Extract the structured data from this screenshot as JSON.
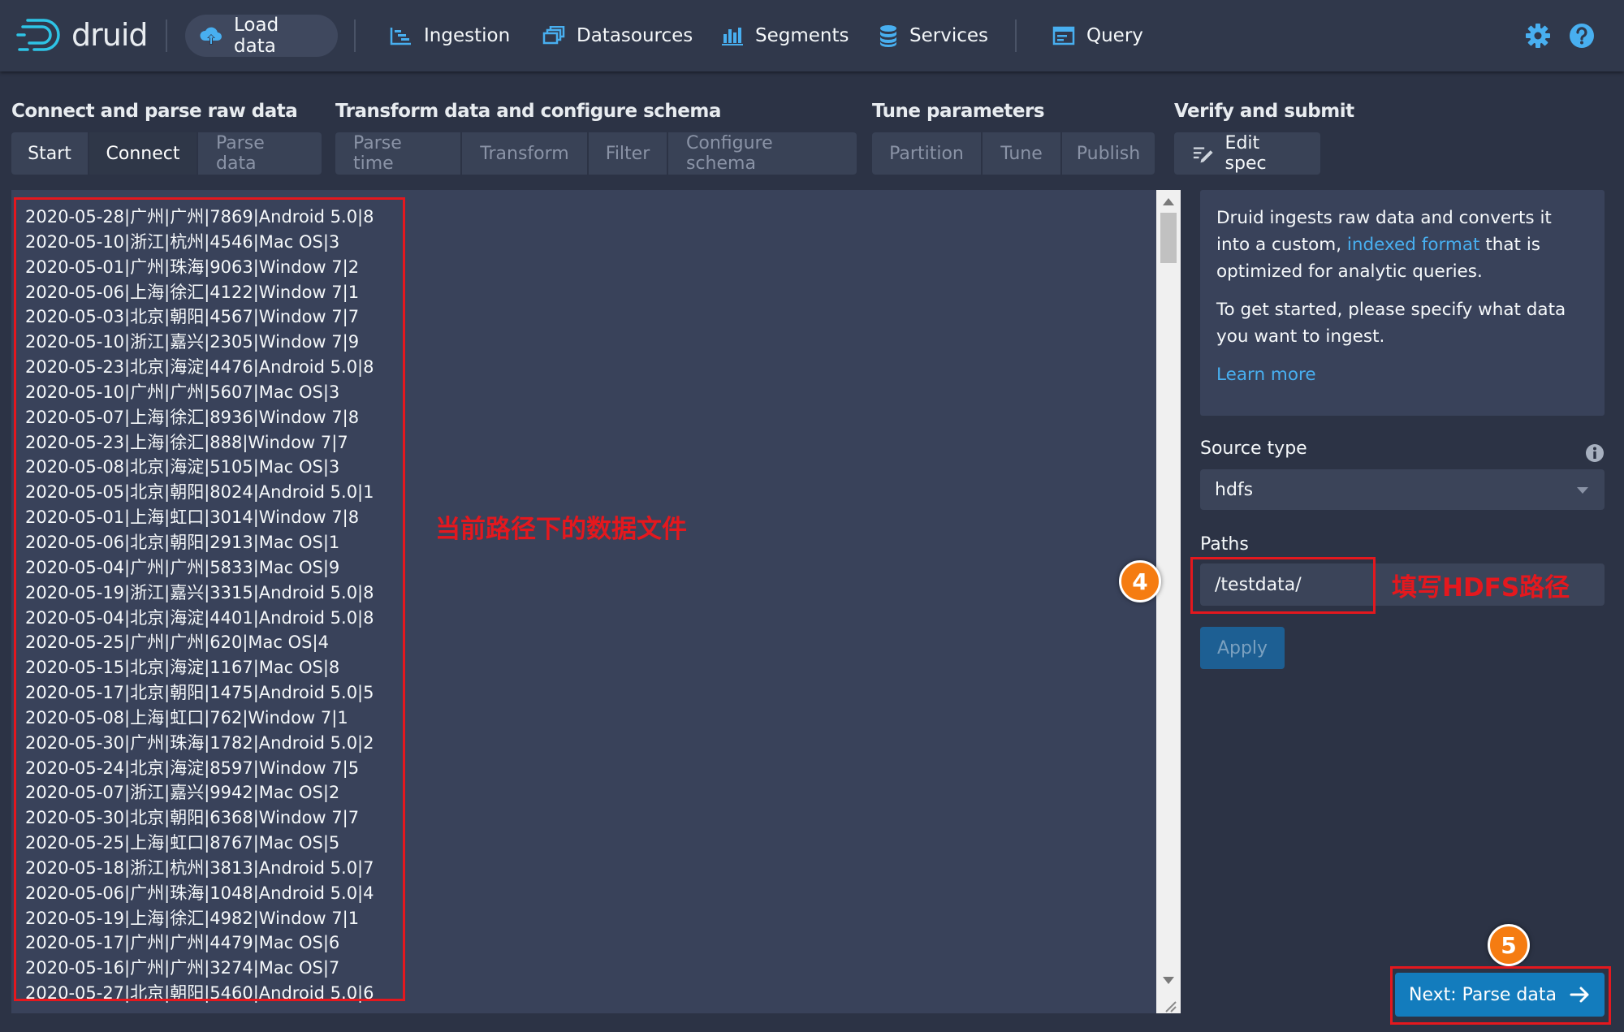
{
  "header": {
    "logo_text": "druid",
    "nav": {
      "load_data": "Load data",
      "ingestion": "Ingestion",
      "datasources": "Datasources",
      "segments": "Segments",
      "services": "Services",
      "query": "Query"
    }
  },
  "steps": {
    "connect_parse": {
      "title": "Connect and parse raw data",
      "tabs": [
        "Start",
        "Connect",
        "Parse data"
      ]
    },
    "transform": {
      "title": "Transform data and configure schema",
      "tabs": [
        "Parse time",
        "Transform",
        "Filter",
        "Configure schema"
      ]
    },
    "tune": {
      "title": "Tune parameters",
      "tabs": [
        "Partition",
        "Tune",
        "Publish"
      ]
    },
    "verify": {
      "title": "Verify and submit",
      "tabs": [
        "Edit spec"
      ]
    }
  },
  "raw_data": {
    "lines": [
      "2020-05-28|广州|广州|7869|Android 5.0|8",
      "2020-05-10|浙江|杭州|4546|Mac OS|3",
      "2020-05-01|广州|珠海|9063|Window 7|2",
      "2020-05-06|上海|徐汇|4122|Window 7|1",
      "2020-05-03|北京|朝阳|4567|Window 7|7",
      "2020-05-10|浙江|嘉兴|2305|Window 7|9",
      "2020-05-23|北京|海淀|4476|Android 5.0|8",
      "2020-05-10|广州|广州|5607|Mac OS|3",
      "2020-05-07|上海|徐汇|8936|Window 7|8",
      "2020-05-23|上海|徐汇|888|Window 7|7",
      "2020-05-08|北京|海淀|5105|Mac OS|3",
      "2020-05-05|北京|朝阳|8024|Android 5.0|1",
      "2020-05-01|上海|虹口|3014|Window 7|8",
      "2020-05-06|北京|朝阳|2913|Mac OS|1",
      "2020-05-04|广州|广州|5833|Mac OS|9",
      "2020-05-19|浙江|嘉兴|3315|Android 5.0|8",
      "2020-05-04|北京|海淀|4401|Android 5.0|8",
      "2020-05-25|广州|广州|620|Mac OS|4",
      "2020-05-15|北京|海淀|1167|Mac OS|8",
      "2020-05-17|北京|朝阳|1475|Android 5.0|5",
      "2020-05-08|上海|虹口|762|Window 7|1",
      "2020-05-30|广州|珠海|1782|Android 5.0|2",
      "2020-05-24|北京|海淀|8597|Window 7|5",
      "2020-05-07|浙江|嘉兴|9942|Mac OS|2",
      "2020-05-30|北京|朝阳|6368|Window 7|7",
      "2020-05-25|上海|虹口|8767|Mac OS|5",
      "2020-05-18|浙江|杭州|3813|Android 5.0|7",
      "2020-05-06|广州|珠海|1048|Android 5.0|4",
      "2020-05-19|上海|徐汇|4982|Window 7|1",
      "2020-05-17|广州|广州|4479|Mac OS|6",
      "2020-05-16|广州|广州|3274|Mac OS|7",
      "2020-05-27|北京|朝阳|5460|Android 5.0|6"
    ],
    "annotation": "当前路径下的数据文件"
  },
  "info": {
    "p1_before": "Druid ingests raw data and converts it into a custom, ",
    "p1_link": "indexed format",
    "p1_after": " that is optimized for analytic queries.",
    "p2": "To get started, please specify what data you want to ingest.",
    "learn_more": "Learn more"
  },
  "form": {
    "source_type_label": "Source type",
    "source_type_value": "hdfs",
    "paths_label": "Paths",
    "paths_value": "/testdata/",
    "paths_annotation": "填写HDFS路径",
    "apply_label": "Apply"
  },
  "markers": {
    "step4": "4",
    "step5": "5"
  },
  "next_button": "Next: Parse data",
  "colors": {
    "background": "#2c3345",
    "header": "#30384b",
    "panel": "#39425a",
    "accent_blue": "#137cbd",
    "link_blue": "#48aff0",
    "annotation_red": "#e4181e",
    "marker_orange": "#f57c12"
  }
}
